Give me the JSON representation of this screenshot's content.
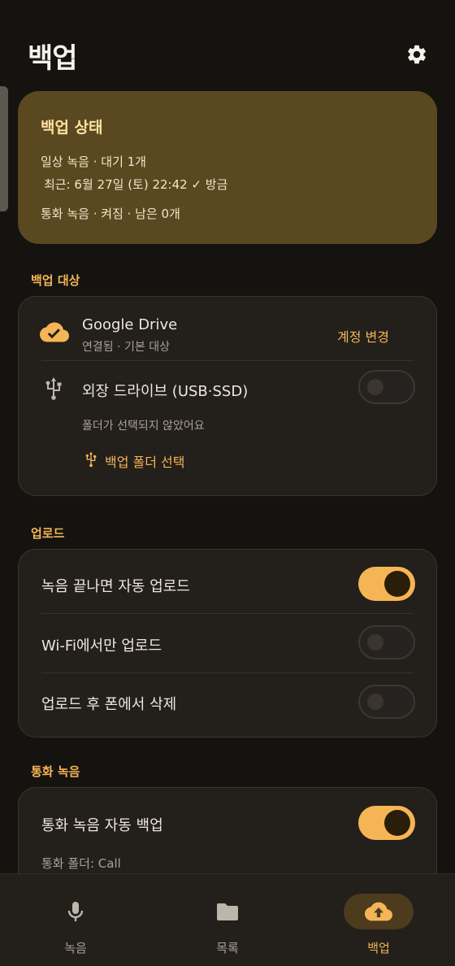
{
  "header": {
    "title": "백업",
    "settings_icon": "gear-icon"
  },
  "status": {
    "title": "백업 상태",
    "daily": "일상 녹음 · 대기 1개",
    "recent": "최근: 6월 27일 (토) 22:42 ✓ 방금",
    "call": "통화 녹음 · 켜짐 · 남은 0개"
  },
  "targets": {
    "section": "백업 대상",
    "drive": {
      "name": "Google Drive",
      "sub": "연결됨 · 기본 대상",
      "action": "계정 변경",
      "icon": "cloud-check-icon"
    },
    "usb": {
      "name": "외장 드라이브 (USB·SSD)",
      "sub": "폴더가 선택되지 않았어요",
      "action": "백업 폴더 선택",
      "enabled": false,
      "icon": "usb-icon"
    }
  },
  "upload": {
    "section": "업로드",
    "items": [
      {
        "label": "녹음 끝나면 자동 업로드",
        "enabled": true
      },
      {
        "label": "Wi-Fi에서만 업로드",
        "enabled": false
      },
      {
        "label": "업로드 후 폰에서 삭제",
        "enabled": false
      }
    ]
  },
  "call": {
    "section": "통화 녹음",
    "auto_label": "통화 녹음 자동 백업",
    "auto_enabled": true,
    "folder": "통화 폴더: Call"
  },
  "nav": {
    "items": [
      {
        "label": "녹음",
        "icon": "mic-icon",
        "active": false
      },
      {
        "label": "목록",
        "icon": "folder-icon",
        "active": false
      },
      {
        "label": "백업",
        "icon": "cloud-upload-icon",
        "active": true
      }
    ]
  },
  "colors": {
    "accent": "#f4b556",
    "background": "#151310",
    "card": "#231f1b",
    "status_card": "#5a4820"
  }
}
